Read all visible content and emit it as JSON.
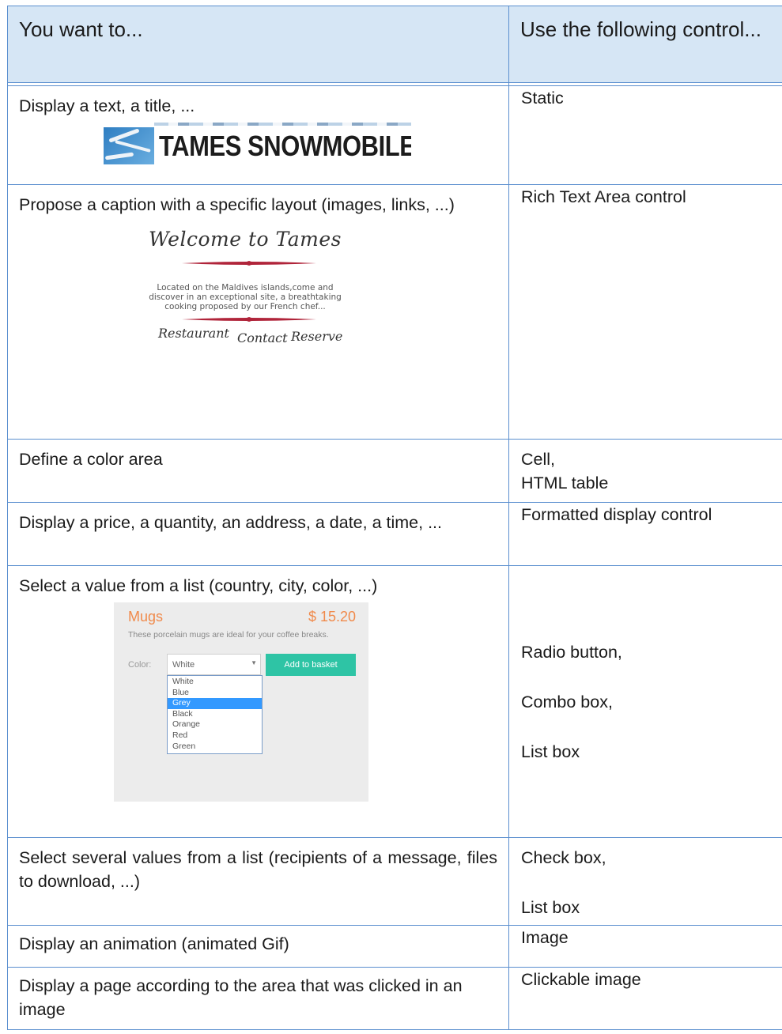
{
  "header": {
    "col1": "You want to...",
    "col2": "Use the following control..."
  },
  "rows": [
    {
      "want": "Display a text, a title, ...",
      "control": "Static",
      "example": {
        "banner_text": "TAMES SNOWMOBILE"
      }
    },
    {
      "want": "Propose a caption with a specific layout (images, links, ...)",
      "control": "Rich Text Area control",
      "example": {
        "welcome": "Welcome to Tames",
        "description": [
          "Located on the Maldives islands,come and",
          "discover in an exceptional site, a breathtaking",
          "cooking proposed by our French chef..."
        ],
        "links": [
          "Restaurant",
          "Contact",
          "Reserve"
        ]
      }
    },
    {
      "want": "Define a color area",
      "control": [
        "Cell,",
        "HTML table"
      ]
    },
    {
      "want": "Display a price, a quantity, an address, a date, a time, ...",
      "control": "Formatted display control"
    },
    {
      "want": "Select a value from a list (country, city, color, ...)",
      "control": [
        "Radio button,",
        "Combo box,",
        "List box"
      ],
      "example": {
        "product": "Mugs",
        "price": "$ 15.20",
        "description": "These porcelain mugs are ideal for your coffee breaks.",
        "color_label": "Color:",
        "selected": "White",
        "button": "Add to basket",
        "options": [
          "White",
          "Blue",
          "Grey",
          "Black",
          "Orange",
          "Red",
          "Green"
        ],
        "highlighted": "Grey"
      }
    },
    {
      "want": "Select several values from a list (recipients of a message, files to download, ...)",
      "control": [
        "Check box,",
        "List box"
      ]
    },
    {
      "want": "Display an animation (animated Gif)",
      "control": "Image"
    },
    {
      "want": "Display a page according to the area that was clicked in an image",
      "control": "Clickable image"
    }
  ],
  "colors": {
    "header_bg": "#d6e6f5",
    "border": "#5b8fcf",
    "accent_orange": "#f08a4b",
    "button_green": "#2ec4a5",
    "list_highlight": "#3399ff",
    "ornament": "#b0243a"
  }
}
